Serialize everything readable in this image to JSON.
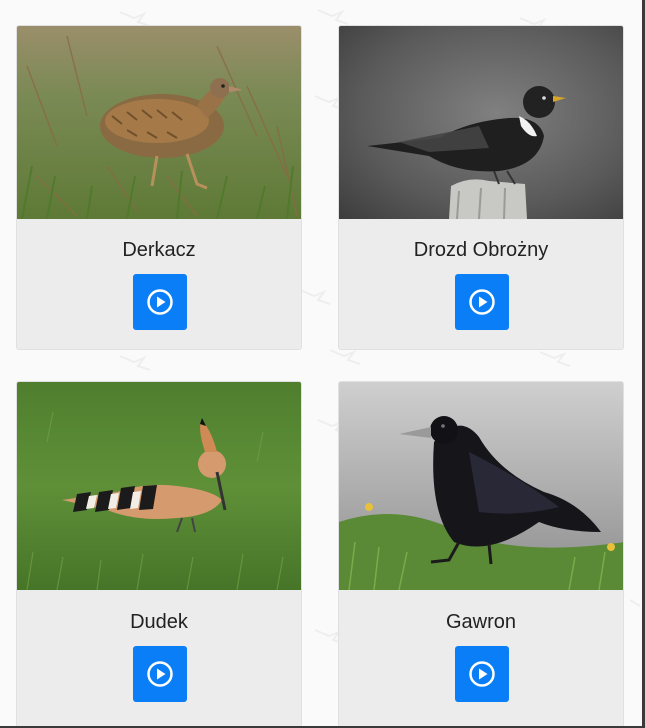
{
  "birds": [
    {
      "name": "Derkacz",
      "button_icon": "play-circle-icon"
    },
    {
      "name": "Drozd Obrożny",
      "button_icon": "play-circle-icon"
    },
    {
      "name": "Dudek",
      "button_icon": "play-circle-icon"
    },
    {
      "name": "Gawron",
      "button_icon": "play-circle-icon"
    }
  ],
  "colors": {
    "button": "#0a7ef6",
    "card_background": "#ececec",
    "page_background": "#fafafa"
  }
}
